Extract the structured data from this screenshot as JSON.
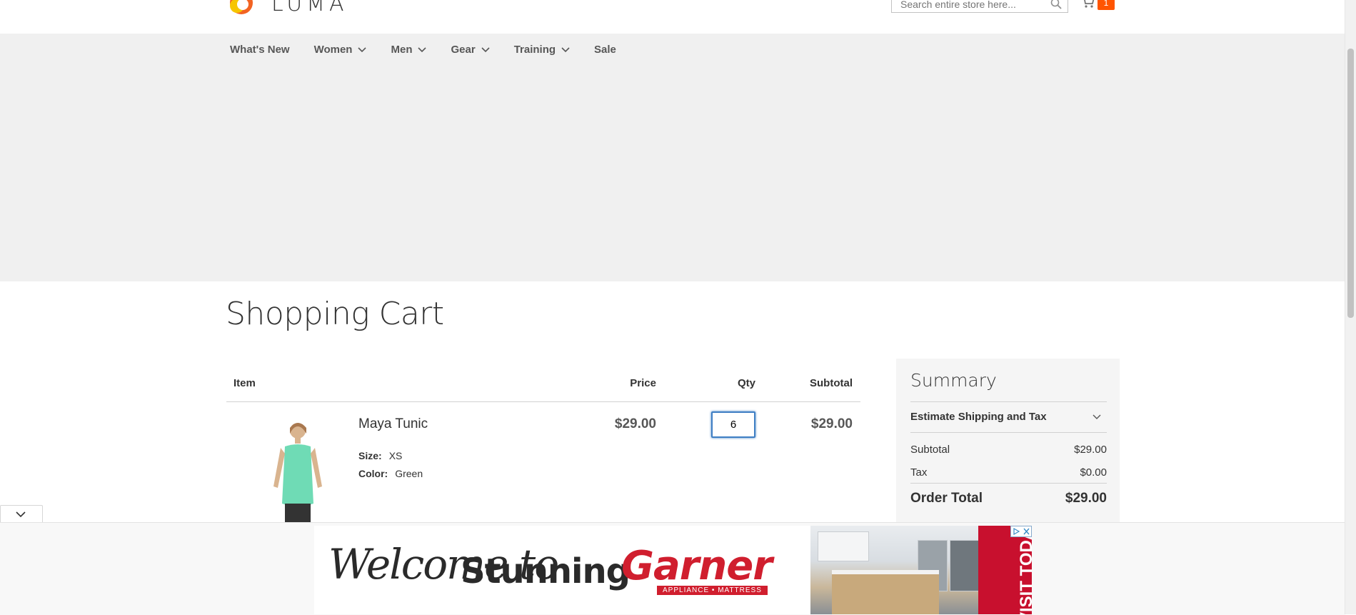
{
  "header": {
    "logo_text": "LUMA",
    "search_placeholder": "Search entire store here...",
    "cart_count": "1"
  },
  "nav": {
    "items": [
      {
        "label": "What's New",
        "dropdown": false
      },
      {
        "label": "Women",
        "dropdown": true
      },
      {
        "label": "Men",
        "dropdown": true
      },
      {
        "label": "Gear",
        "dropdown": true
      },
      {
        "label": "Training",
        "dropdown": true
      },
      {
        "label": "Sale",
        "dropdown": false
      }
    ]
  },
  "page": {
    "title": "Shopping Cart"
  },
  "cart": {
    "headers": {
      "item": "Item",
      "price": "Price",
      "qty": "Qty",
      "subtotal": "Subtotal"
    },
    "items": [
      {
        "name": "Maya Tunic",
        "size_label": "Size:",
        "size": "XS",
        "color_label": "Color:",
        "color": "Green",
        "price": "$29.00",
        "qty": "6",
        "subtotal": "$29.00"
      }
    ]
  },
  "summary": {
    "title": "Summary",
    "estimate_label": "Estimate Shipping and Tax",
    "subtotal_label": "Subtotal",
    "subtotal_value": "$29.00",
    "tax_label": "Tax",
    "tax_value": "$0.00",
    "order_total_label": "Order Total",
    "order_total_value": "$29.00"
  },
  "ad": {
    "welcome": "Welcome to",
    "stunning": "Stunning",
    "brand": "Garner",
    "brand_sub": "APPLIANCE • MATTRESS",
    "cta": "VISIT TODAY"
  },
  "colors": {
    "accent": "#ff5501",
    "nav_bg": "#f0f0f0",
    "focus_blue": "#3f7fc4",
    "ad_red": "#d01e2e"
  }
}
